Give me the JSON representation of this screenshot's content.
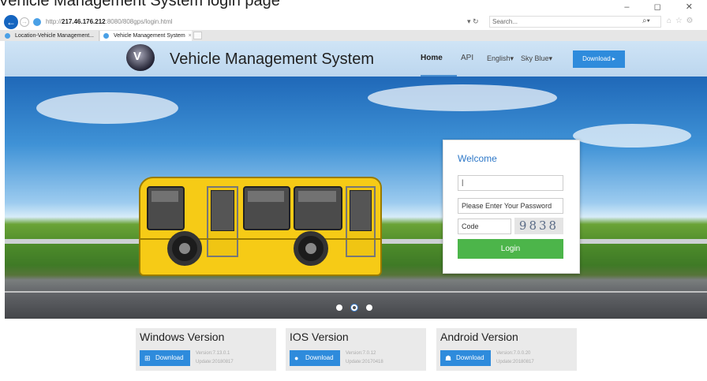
{
  "browser": {
    "top_cut_text": "Vehicle Management System login page",
    "window_controls": "– ◻ ✕",
    "url_prefix": "http://",
    "url_host": "217.46.176.212",
    "url_path": ":8080/808gps/login.html",
    "refresh": "▾ ↻",
    "search_placeholder": "Search...",
    "search_icon": "magnifier-icon",
    "toolbar_icons": "⌂ ☆ ⚙",
    "tabs": [
      {
        "label": "Location-Vehicle Management..."
      },
      {
        "label": "Vehicle Management System",
        "close": "×"
      }
    ]
  },
  "header": {
    "title": "Vehicle Management System",
    "nav": {
      "home": "Home",
      "api": "API",
      "language": "English▾",
      "skin": "Sky Blue▾"
    },
    "download": "Download ▸",
    "logo_glyph": "V",
    "accent": "#2e8bdc"
  },
  "login": {
    "title": "Welcome",
    "username_value": "|",
    "password_placeholder": "Please Enter Your Password",
    "code_placeholder": "Code",
    "captcha": "9838",
    "button": "Login",
    "button_color": "#4cb54a"
  },
  "carousel": {
    "active_index": 1,
    "count": 3
  },
  "versions": [
    {
      "title": "Windows Version",
      "button": "Download",
      "icon": "windows-icon",
      "glyph": "⊞",
      "version": "Version:7.13.0.1",
      "update": "Update:20180817"
    },
    {
      "title": "IOS Version",
      "button": "Download",
      "icon": "apple-icon",
      "glyph": "",
      "version": "Version:7.0.12",
      "update": "Update:20170418"
    },
    {
      "title": "Android Version",
      "button": "Download",
      "icon": "android-icon",
      "glyph": "☗",
      "version": "Version:7.0.0.20",
      "update": "Update:20180817"
    }
  ]
}
